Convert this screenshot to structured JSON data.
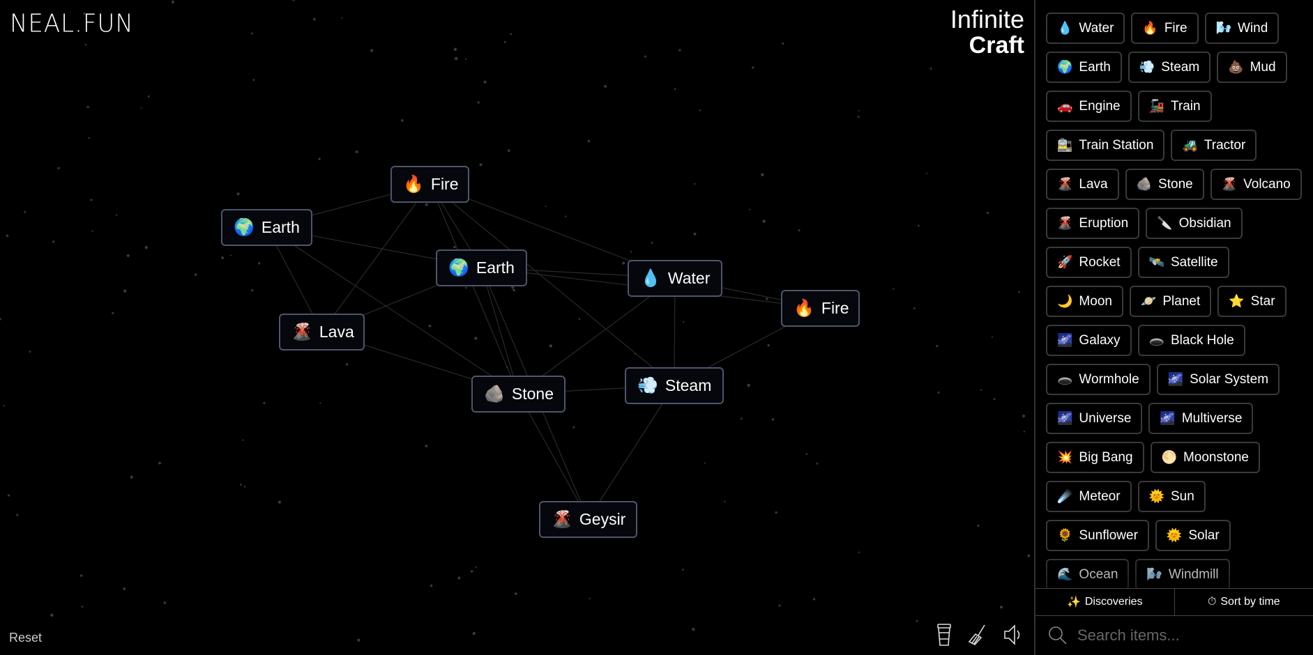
{
  "logo": "NEAL.FUN",
  "title": {
    "line1": "Infinite",
    "line2": "Craft"
  },
  "canvas_elements": [
    {
      "emoji": "🌍",
      "label": "Earth"
    },
    {
      "emoji": "🔥",
      "label": "Fire"
    },
    {
      "emoji": "🌍",
      "label": "Earth"
    },
    {
      "emoji": "💧",
      "label": "Water"
    },
    {
      "emoji": "🔥",
      "label": "Fire"
    },
    {
      "emoji": "🌋",
      "label": "Lava"
    },
    {
      "emoji": "🪨",
      "label": "Stone"
    },
    {
      "emoji": "💨",
      "label": "Steam"
    },
    {
      "emoji": "🌋",
      "label": "Geysir"
    }
  ],
  "reset_label": "Reset",
  "tools": {
    "coffee": "coffee-cup-icon",
    "clear": "broom-icon",
    "sound": "speaker-icon"
  },
  "sidebar": {
    "items": [
      {
        "emoji": "💧",
        "label": "Water"
      },
      {
        "emoji": "🔥",
        "label": "Fire"
      },
      {
        "emoji": "🌬️",
        "label": "Wind"
      },
      {
        "emoji": "🌍",
        "label": "Earth"
      },
      {
        "emoji": "💨",
        "label": "Steam"
      },
      {
        "emoji": "💩",
        "label": "Mud"
      },
      {
        "emoji": "🚗",
        "label": "Engine"
      },
      {
        "emoji": "🚂",
        "label": "Train"
      },
      {
        "emoji": "🚉",
        "label": "Train Station"
      },
      {
        "emoji": "🚜",
        "label": "Tractor"
      },
      {
        "emoji": "🌋",
        "label": "Lava"
      },
      {
        "emoji": "🪨",
        "label": "Stone"
      },
      {
        "emoji": "🌋",
        "label": "Volcano"
      },
      {
        "emoji": "🌋",
        "label": "Eruption"
      },
      {
        "emoji": "🔪",
        "label": "Obsidian"
      },
      {
        "emoji": "🚀",
        "label": "Rocket"
      },
      {
        "emoji": "🛰️",
        "label": "Satellite"
      },
      {
        "emoji": "🌙",
        "label": "Moon"
      },
      {
        "emoji": "🪐",
        "label": "Planet"
      },
      {
        "emoji": "⭐",
        "label": "Star"
      },
      {
        "emoji": "🌌",
        "label": "Galaxy"
      },
      {
        "emoji": "🕳️",
        "label": "Black Hole"
      },
      {
        "emoji": "🕳️",
        "label": "Wormhole"
      },
      {
        "emoji": "🌌",
        "label": "Solar System"
      },
      {
        "emoji": "🌌",
        "label": "Universe"
      },
      {
        "emoji": "🌌",
        "label": "Multiverse"
      },
      {
        "emoji": "💥",
        "label": "Big Bang"
      },
      {
        "emoji": "🌕",
        "label": "Moonstone"
      },
      {
        "emoji": "☄️",
        "label": "Meteor"
      },
      {
        "emoji": "🌞",
        "label": "Sun"
      },
      {
        "emoji": "🌻",
        "label": "Sunflower"
      },
      {
        "emoji": "🌞",
        "label": "Solar"
      },
      {
        "emoji": "🌊",
        "label": "Ocean"
      },
      {
        "emoji": "🌬️",
        "label": "Windmill"
      }
    ],
    "discoveries_label": "Discoveries",
    "sort_label": "Sort by time",
    "search_placeholder": "Search items..."
  }
}
